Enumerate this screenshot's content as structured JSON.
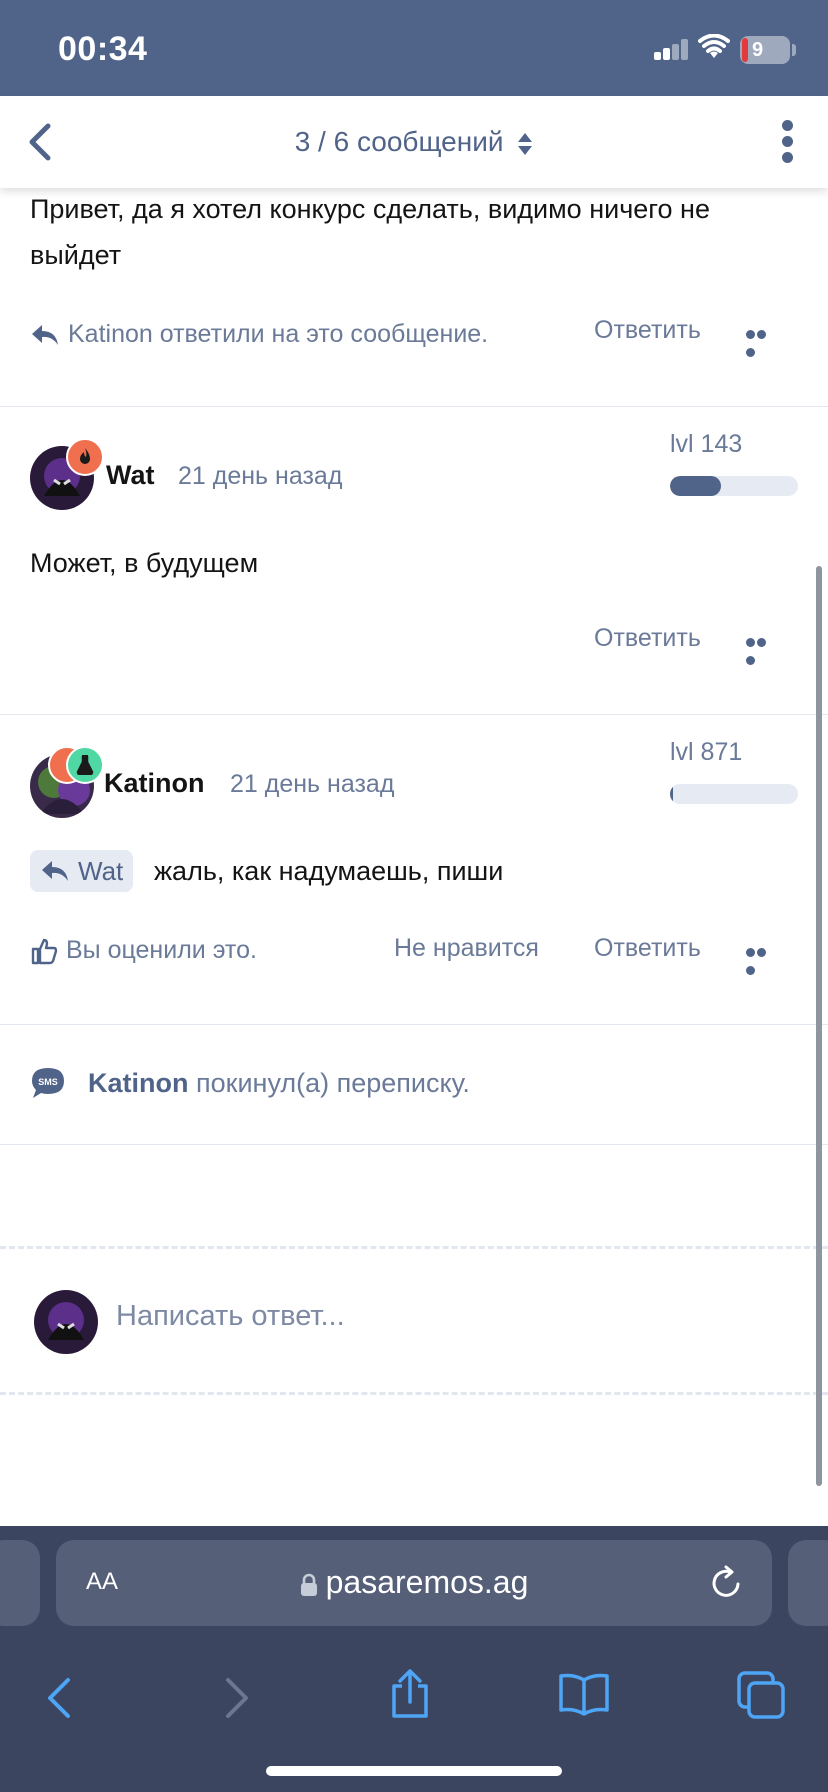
{
  "status": {
    "time": "00:34",
    "battery": "9"
  },
  "nav": {
    "title": "3 / 6 сообщений"
  },
  "messages": [
    {
      "text": "Привет, да я хотел конкурс сделать, видимо ничего не выйдет",
      "reply_note": "Katinon ответили на это сообщение.",
      "reply_label": "Ответить"
    },
    {
      "author": "Wat",
      "time": "21 день назад",
      "level": "lvl 143",
      "level_progress": 0.4,
      "text": "Может, в будущем",
      "reply_label": "Ответить",
      "badge_color": "#ef6f4e"
    },
    {
      "author": "Katinon",
      "time": "21 день назад",
      "level": "lvl 871",
      "level_progress": 0.02,
      "quote_chip": "Wat",
      "text": "жаль, как надумаешь, пиши",
      "liked_note": "Вы оценили это.",
      "dislike_label": "Не нравится",
      "reply_label": "Ответить",
      "badge_colors": [
        "#ef6f4e",
        "#4fd8a4"
      ]
    }
  ],
  "system_note": {
    "user": "Katinon",
    "text": "покинул(а) переписку.",
    "icon": "sms-icon"
  },
  "composer": {
    "placeholder": "Написать ответ..."
  },
  "browser": {
    "aa": "AA",
    "url": "pasaremos.ag"
  },
  "colors": {
    "accent": "#506389",
    "muted": "#6a7a98",
    "safari_bg": "#3b4560"
  }
}
